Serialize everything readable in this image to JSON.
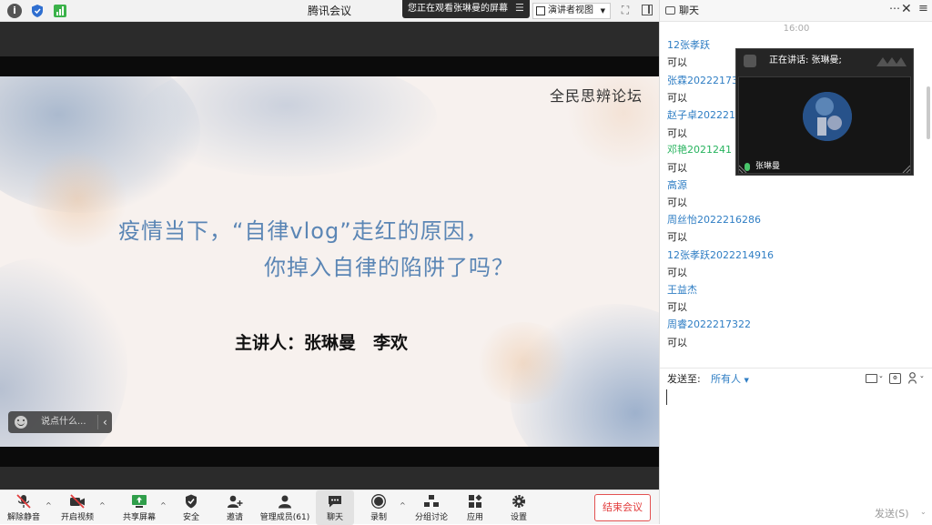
{
  "topbar": {
    "app_title": "腾讯会议",
    "viewing_banner": "您正在观看张琳曼的屏幕",
    "view_mode_label": "演讲者视图"
  },
  "slide": {
    "brand": "全民思辨论坛",
    "title_line1": "疫情当下，“自律vlog”走红的原因，",
    "title_line2": "你掉入自律的陷阱了吗？",
    "speaker_line": "主讲人：张琳曼　李欢"
  },
  "say_bar": {
    "placeholder": "说点什么..."
  },
  "toolbar": {
    "unmute": "解除静音",
    "video": "开启视频",
    "share": "共享屏幕",
    "security": "安全",
    "invite": "邀请",
    "members": "管理成员(61)",
    "chat": "聊天",
    "record": "录制",
    "breakout": "分组讨论",
    "apps": "应用",
    "settings": "设置",
    "end_meeting": "结束会议"
  },
  "chat": {
    "title": "聊天",
    "time": "16:00",
    "messages": [
      {
        "name": "12张孝跃",
        "text": "可以"
      },
      {
        "name": "张霖2022217332",
        "text": "可以"
      },
      {
        "name": "赵子卓2022214",
        "text": "可以"
      },
      {
        "name": "邓艳2021241",
        "text": "可以"
      },
      {
        "name": "高源",
        "text": "可以"
      },
      {
        "name": "周丝怡2022216286",
        "text": "可以"
      },
      {
        "name": "12张孝跃2022214916",
        "text": "可以"
      },
      {
        "name": "王益杰",
        "text": "可以"
      },
      {
        "name": "周睿2022217322",
        "text": "可以"
      }
    ],
    "send_to_label": "发送至:",
    "recipient": "所有人",
    "send_button": "发送(S)"
  },
  "speaker": {
    "label": "正在讲话: 张琳曼;",
    "name": "张琳曼"
  },
  "colors": {
    "accent_blue": "#2f7ec4",
    "end_red": "#e23c3c",
    "slide_title_blue": "#5b86b5",
    "mic_green": "#49c46a"
  }
}
